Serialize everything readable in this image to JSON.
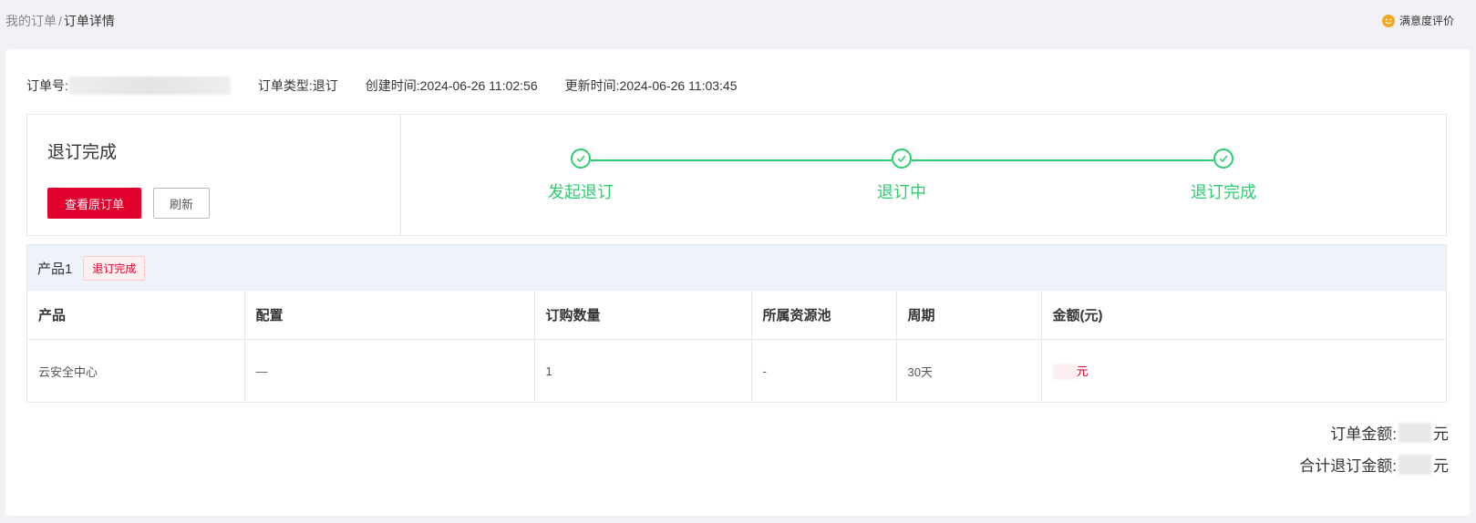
{
  "breadcrumb": {
    "parent": "我的订单",
    "separator": "/",
    "current": "订单详情"
  },
  "feedback": {
    "label": "满意度评价",
    "icon": "smile-icon"
  },
  "order_meta": {
    "order_no_label": "订单号:",
    "order_type_label": "订单类型:",
    "order_type_value": "退订",
    "created_label": "创建时间:",
    "created_value": "2024-06-26 11:02:56",
    "updated_label": "更新时间:",
    "updated_value": "2024-06-26 11:03:45"
  },
  "status": {
    "title": "退订完成",
    "view_original_label": "查看原订单",
    "refresh_label": "刷新"
  },
  "steps": [
    {
      "label": "发起退订",
      "done": true
    },
    {
      "label": "退订中",
      "done": true
    },
    {
      "label": "退订完成",
      "done": true
    }
  ],
  "product": {
    "name": "产品1",
    "tag": "退订完成",
    "columns": [
      "产品",
      "配置",
      "订购数量",
      "所属资源池",
      "周期",
      "金额(元)"
    ],
    "rows": [
      {
        "product": "云安全中心",
        "config": "—",
        "quantity": "1",
        "pool": "-",
        "period": "30天",
        "amount_unit": "元"
      }
    ]
  },
  "summary": {
    "order_amount_label": "订单金额:",
    "order_amount_unit": "元",
    "refund_total_label": "合计退订金额:",
    "refund_total_unit": "元"
  },
  "colors": {
    "accent_red": "#e1002d",
    "success_green": "#2ecc71",
    "background": "#f0f2f5"
  }
}
